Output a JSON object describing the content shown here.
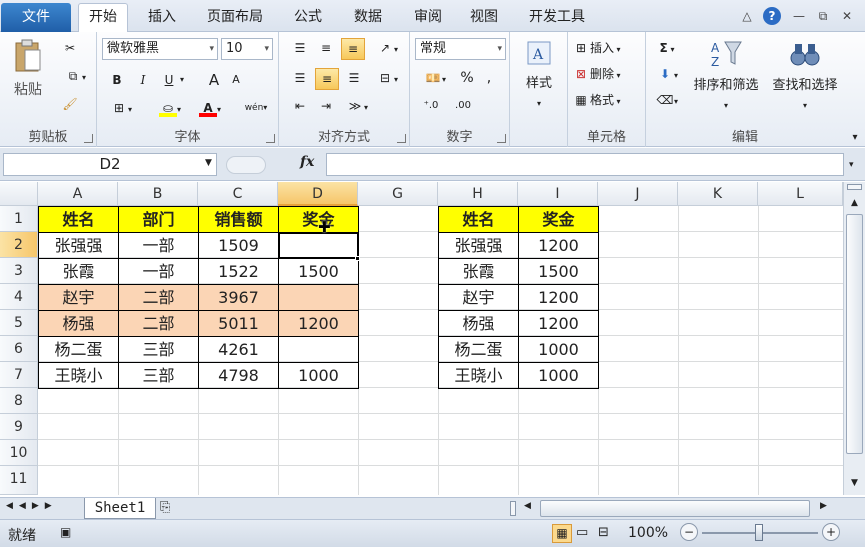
{
  "tabs": [
    "文件",
    "开始",
    "插入",
    "页面布局",
    "公式",
    "数据",
    "审阅",
    "视图",
    "开发工具"
  ],
  "window_controls": [
    "△",
    "?",
    "—",
    "⧉",
    "✕"
  ],
  "ribbon": {
    "clipboard": {
      "label": "剪贴板",
      "paste": "粘贴"
    },
    "font": {
      "label": "字体",
      "name": "微软雅黑",
      "size": "10",
      "bold": "B",
      "italic": "I",
      "underline": "U",
      "grow": "A",
      "shrink": "A",
      "phonetic": "wén"
    },
    "alignment": {
      "label": "对齐方式"
    },
    "number": {
      "label": "数字",
      "format": "常规",
      "percent": "%",
      "comma": ","
    },
    "styles": {
      "label": "样式"
    },
    "cells": {
      "label": "单元格",
      "insert": "插入",
      "delete": "删除",
      "format": "格式"
    },
    "editing": {
      "label": "编辑",
      "sum": "Σ",
      "sort_filter": "排序和筛选",
      "find_select": "查找和选择"
    }
  },
  "formula_bar": {
    "name_box": "D2",
    "fx": "fx",
    "formula": ""
  },
  "columns": [
    "A",
    "B",
    "C",
    "D",
    "G",
    "H",
    "I",
    "J",
    "K",
    "L"
  ],
  "rows": [
    "1",
    "2",
    "3",
    "4",
    "5",
    "6",
    "7",
    "8",
    "9",
    "10",
    "11"
  ],
  "table1": {
    "headers": [
      "姓名",
      "部门",
      "销售额",
      "奖金"
    ],
    "rows": [
      [
        "张强强",
        "一部",
        "1509",
        ""
      ],
      [
        "张霞",
        "一部",
        "1522",
        "1500"
      ],
      [
        "赵宇",
        "二部",
        "3967",
        ""
      ],
      [
        "杨强",
        "二部",
        "5011",
        "1200"
      ],
      [
        "杨二蛋",
        "三部",
        "4261",
        ""
      ],
      [
        "王晓小",
        "三部",
        "4798",
        "1000"
      ]
    ]
  },
  "table2": {
    "headers": [
      "姓名",
      "奖金"
    ],
    "rows": [
      [
        "张强强",
        "1200"
      ],
      [
        "张霞",
        "1500"
      ],
      [
        "赵宇",
        "1200"
      ],
      [
        "杨强",
        "1200"
      ],
      [
        "杨二蛋",
        "1000"
      ],
      [
        "王晓小",
        "1000"
      ]
    ]
  },
  "sheet_tab": "Sheet1",
  "status": {
    "ready": "就绪",
    "zoom": "100%"
  },
  "colors": {
    "header_fill": "#ffff00",
    "highlight_fill": "#fbd5b5",
    "selected_header": "#f6c66a"
  }
}
